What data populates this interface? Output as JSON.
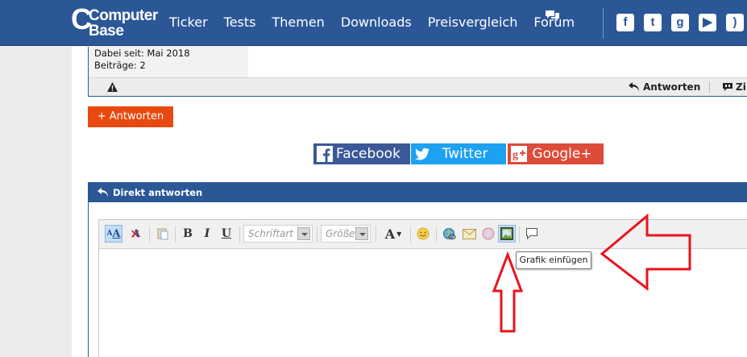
{
  "header": {
    "logo_line1": "Computer",
    "logo_line2": "Base",
    "nav": [
      "Ticker",
      "Tests",
      "Themen",
      "Downloads",
      "Preisvergleich",
      "Forum"
    ],
    "social_icons": [
      "facebook-icon",
      "twitter-icon",
      "googleplus-icon",
      "youtube-icon",
      "rss-icon"
    ],
    "brand_color": "#2b5797"
  },
  "post": {
    "joined": "Dabei seit: Mai 2018",
    "posts": "Beiträge: 2",
    "reply_label": "Antworten",
    "quote_label": "Zi"
  },
  "reply_button": "+ Antworten",
  "share": {
    "facebook": "Facebook",
    "twitter": "Twitter",
    "googleplus": "Google+"
  },
  "direct_reply": {
    "title": "Direkt antworten",
    "font_placeholder": "Schriftart",
    "size_placeholder": "Größe",
    "tooltip": "Grafik einfügen"
  },
  "colors": {
    "accent": "#e8490f",
    "annotation": "#e8141c"
  }
}
